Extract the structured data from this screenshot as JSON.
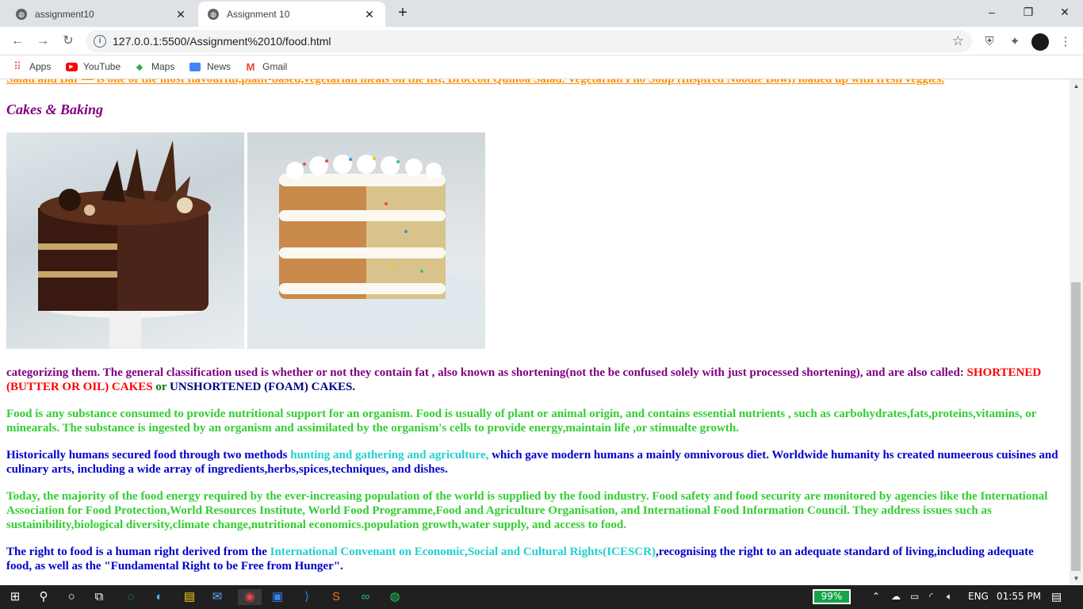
{
  "tabs": [
    {
      "title": "assignment10"
    },
    {
      "title": "Assignment 10"
    }
  ],
  "address_bar": {
    "url": "127.0.0.1:5500/Assignment%2010/food.html"
  },
  "bookmarks": [
    {
      "label": "Apps",
      "icon": "apps-grid-icon"
    },
    {
      "label": "YouTube",
      "icon": "youtube-icon"
    },
    {
      "label": "Maps",
      "icon": "maps-icon"
    },
    {
      "label": "News",
      "icon": "news-icon"
    },
    {
      "label": "Gmail",
      "icon": "gmail-icon"
    }
  ],
  "page": {
    "cutoff_text": "Salad and Bar  —  is one of the most flavourful,plant-based,vegetarian meals on the list, Broccoli Quinoa Salad. Vegetarian Pho Soup (Inspired Noodle Bowl) loaded up with fresh veggies.",
    "heading": "Cakes & Baking",
    "images": [
      {
        "alt": "chocolate-cake"
      },
      {
        "alt": "funfetti-layer-cake"
      }
    ],
    "p1": {
      "text": "categorizing them. The general classification used is whether or not they contain fat , also known as shortening(not the be confused solely with just processed shortening), and are also called:",
      "red": "SHORTENED (BUTTER OR OIL) CAKES",
      "or": " or ",
      "blue": "UNSHORTENED (FOAM) CAKES."
    },
    "p2": "Food is any substance consumed to provide nutritional support for an organism. Food is usually of plant or animal origin, and contains essential nutrients , such as carbohydrates,fats,proteins,vitamins, or minearals. The substance is ingested by an organism and assimilated by the organism's cells to provide energy,maintain life ,or stimualte growth.",
    "p3": {
      "before": "Historically humans secured food through two methods ",
      "highlight": "hunting and gathering and agriculture,",
      "after": " which gave modern humans a mainly omnivorous diet. Worldwide humanity hs created numeerous cuisines and culinary arts, including a wide array of ingredients,herbs,spices,techniques, and dishes."
    },
    "p4": "Today, the majority of the food energy required by the ever-increasing population of the world is supplied by the food industry. Food safety and food security are monitored by agencies like the International Association for Food Protection,World Resources Institute, World Food Programme,Food and Agriculture Organisation, and International Food Information Council. They address issues such as sustainibility,biological diversity,climate change,nutritional economics.population growth,water supply, and access to food.",
    "p5": {
      "before": "The right to food is a human right derived from the ",
      "highlight": "International Convenant on Economic,Social and Cultural Rights(ICESCR)",
      "after": ",recognising the right to an adequate standard of living,including adequate food, as well as the \"Fundamental Right to be Free from Hunger\"."
    }
  },
  "taskbar": {
    "battery": "99%",
    "lang": "ENG",
    "time": "01:55 PM"
  },
  "colors": {
    "heading": "#800080",
    "p1": "#800080",
    "red": "#ff0000",
    "green_text": "#32cd32",
    "blue_text": "#0000cd",
    "cyan_text": "#20d0d0",
    "cutoff": "#ff8c00"
  }
}
